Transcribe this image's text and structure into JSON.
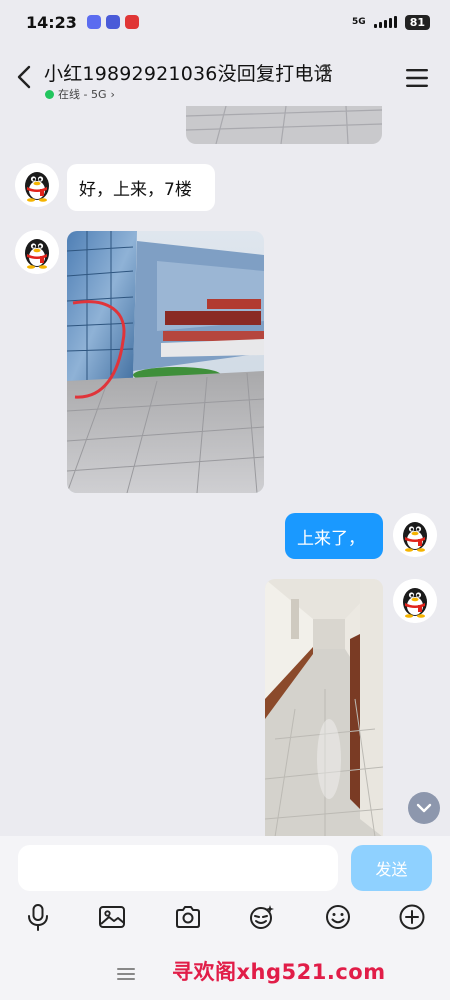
{
  "status_bar": {
    "time": "14:23",
    "network": "5G",
    "battery": "81"
  },
  "header": {
    "title": "小红19892921036没回复打电话",
    "status": "在线 - 5G",
    "status_arrow": "›"
  },
  "messages": [
    {
      "side": "in",
      "type": "text",
      "text": "好，上来，7楼"
    },
    {
      "side": "in",
      "type": "image",
      "description": "building-exterior"
    },
    {
      "side": "out",
      "type": "text",
      "text": "上来了，"
    },
    {
      "side": "out",
      "type": "image",
      "description": "corridor"
    }
  ],
  "input": {
    "value": "",
    "placeholder": "",
    "send_label": "发送"
  },
  "toolbar": [
    "microphone-icon",
    "image-icon",
    "camera-icon",
    "sticker-icon",
    "emoji-icon",
    "plus-icon"
  ],
  "watermark": "寻欢阁xhg521.com"
}
